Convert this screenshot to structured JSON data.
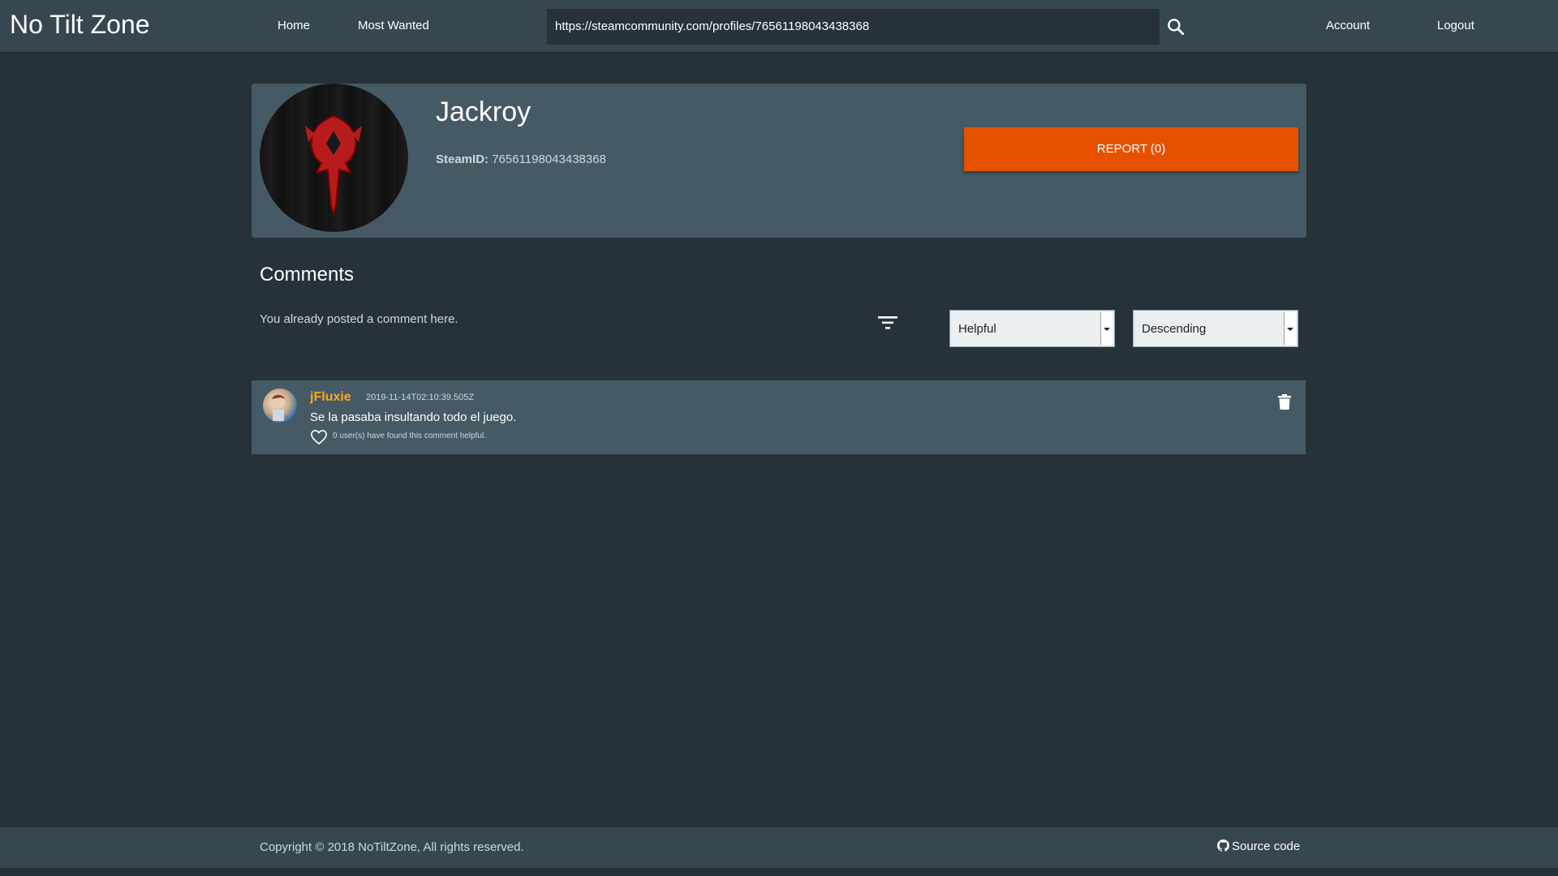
{
  "navbar": {
    "brand": "No Tilt Zone",
    "home": "Home",
    "most_wanted": "Most Wanted",
    "search_value": "https://steamcommunity.com/profiles/76561198043438368",
    "account": "Account",
    "logout": "Logout"
  },
  "profile": {
    "name": "Jackroy",
    "steamid_label": "SteamID:",
    "steamid_value": "76561198043438368",
    "report_label": "REPORT (0)"
  },
  "comments": {
    "title": "Comments",
    "already_posted": "You already posted a comment here.",
    "sort_by": "Helpful",
    "order": "Descending",
    "items": [
      {
        "author": "jFluxie",
        "date": "2019-11-14T02:10:39.505Z",
        "text": "Se la pasaba insultando todo el juego.",
        "helpful": "0 user(s) have found this comment helpful."
      }
    ]
  },
  "footer": {
    "copyright": "Copyright © 2018 NoTiltZone, All rights reserved.",
    "source_code": "Source code"
  },
  "colors": {
    "background": "#263238",
    "panel": "#455a64",
    "navbar": "#37474f",
    "accent_report": "#e65100",
    "author": "#ffa726"
  }
}
